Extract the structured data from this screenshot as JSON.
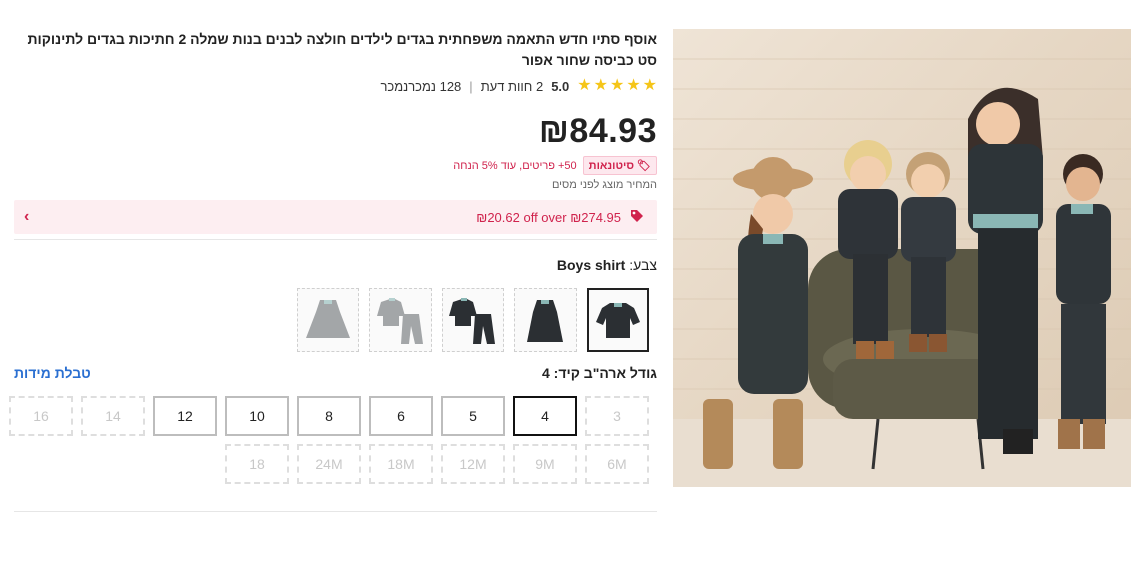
{
  "product": {
    "title": "אוסף סתיו חדש התאמה משפחתית בגדים לילדים חולצה לבנים בנות שמלה 2 חתיכות בגדים לתינוקות סט כביסה שחור אפור",
    "rating_score": "5.0",
    "reviews_text": "2 חוות דעת",
    "sold_text": "128 נמכרנמכר",
    "price": "₪84.93",
    "wholesale_badge": "סיטונאות",
    "wholesale_text": "50+ פריטים, עוד 5% הנחה",
    "tax_note": "המחיר מוצג לפני מסים",
    "stars_count": 5,
    "accent_color": "#d0234d"
  },
  "coupon": {
    "text": "₪20.62 off over ₪274.95",
    "chevron": "‹"
  },
  "color": {
    "label": "צבע:",
    "selected_value": "Boys shirt",
    "swatches": [
      "boys-shirt",
      "girls-dress",
      "boys-set",
      "girls-set",
      "girls-dress-grey"
    ]
  },
  "size": {
    "label": "גודל ארה\"ב קיד: 4",
    "chart_link": "טבלת מידות",
    "row1": [
      {
        "label": "3",
        "state": "disabled"
      },
      {
        "label": "4",
        "state": "selected"
      },
      {
        "label": "5",
        "state": "available"
      },
      {
        "label": "6",
        "state": "available"
      },
      {
        "label": "8",
        "state": "available"
      },
      {
        "label": "10",
        "state": "available"
      },
      {
        "label": "12",
        "state": "available"
      },
      {
        "label": "14",
        "state": "disabled"
      },
      {
        "label": "16",
        "state": "disabled"
      }
    ],
    "row2": [
      {
        "label": "6M",
        "state": "disabled"
      },
      {
        "label": "9M",
        "state": "disabled"
      },
      {
        "label": "12M",
        "state": "disabled"
      },
      {
        "label": "18M",
        "state": "disabled"
      },
      {
        "label": "24M",
        "state": "disabled"
      },
      {
        "label": "18",
        "state": "disabled"
      }
    ]
  }
}
